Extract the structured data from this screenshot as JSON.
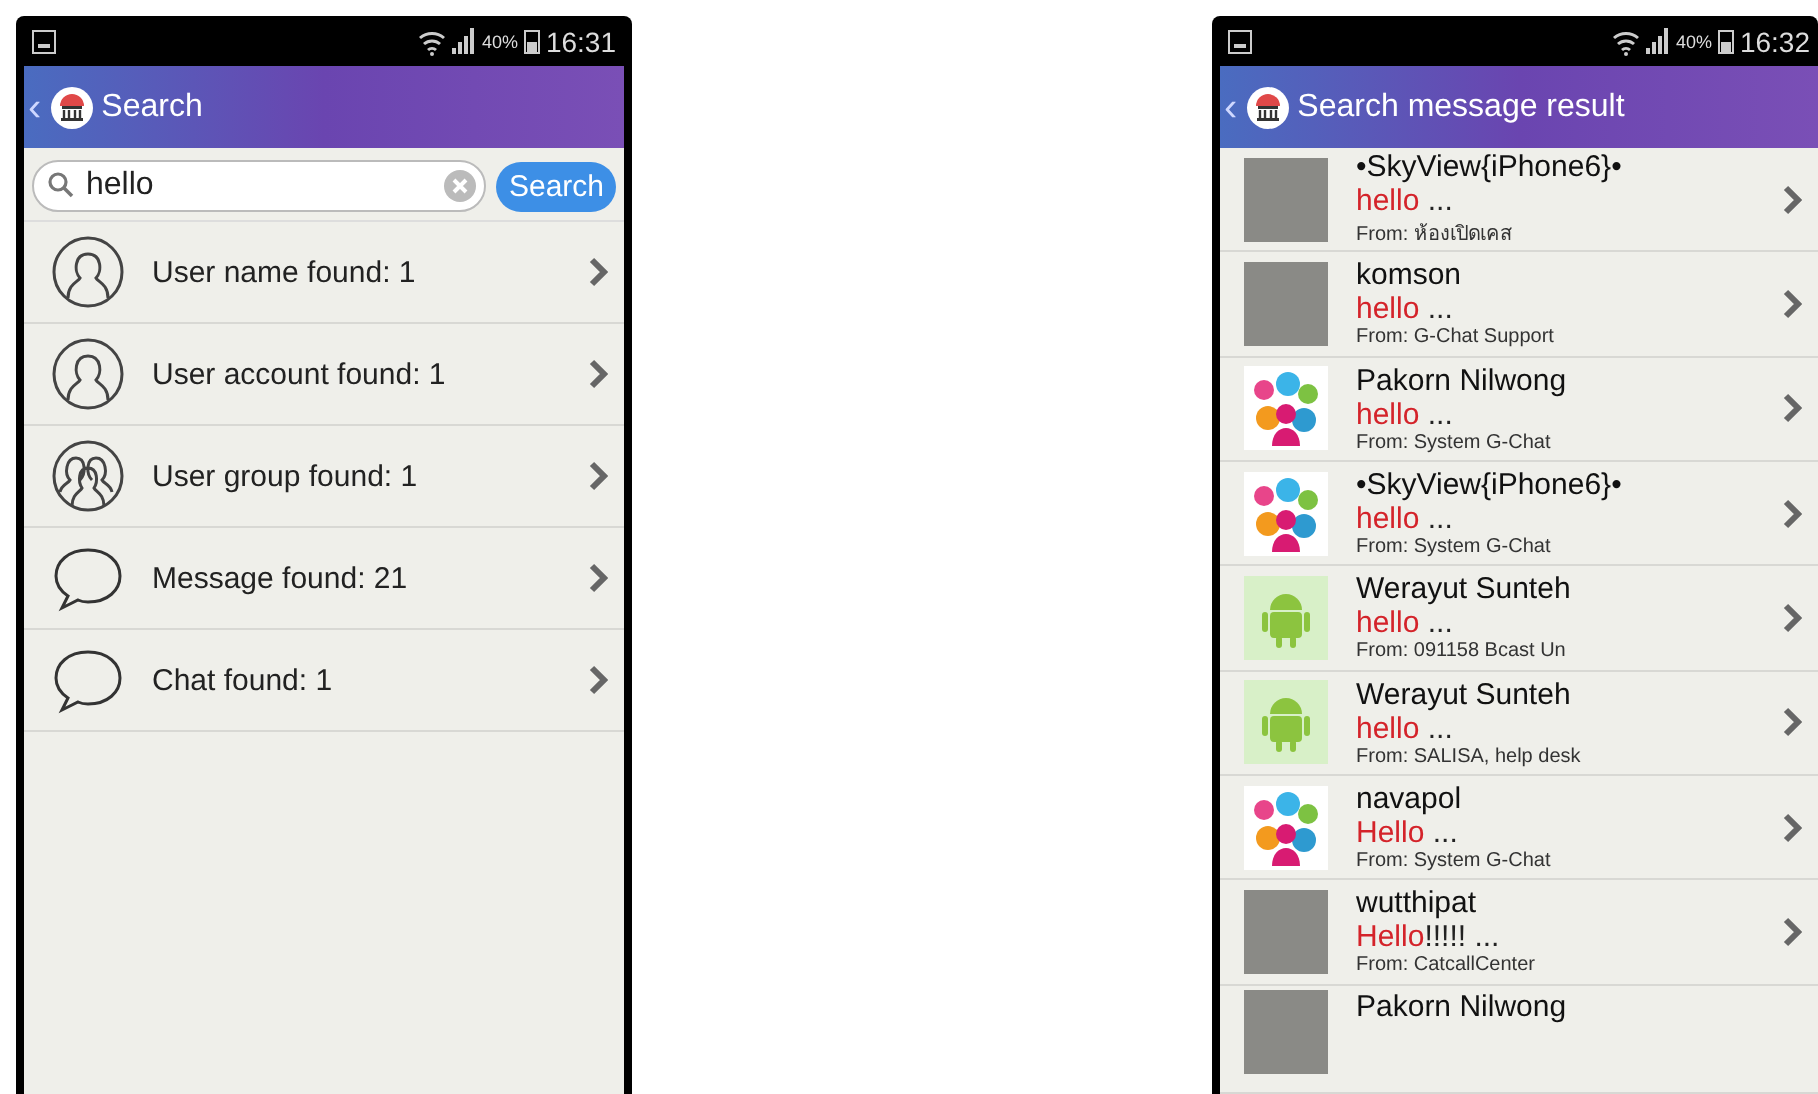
{
  "search_screen": {
    "status_bar": {
      "battery": "40%",
      "time": "16:31"
    },
    "app_bar": {
      "back": "‹",
      "title": "Search"
    },
    "search": {
      "value": "hello",
      "button": "Search"
    },
    "results": [
      {
        "kind": "user",
        "label": "User name found: 1"
      },
      {
        "kind": "user",
        "label": "User account found: 1"
      },
      {
        "kind": "group",
        "label": "User group found: 1"
      },
      {
        "kind": "message",
        "label": "Message found: 21"
      },
      {
        "kind": "message",
        "label": "Chat found: 1"
      }
    ]
  },
  "result_screen": {
    "status_bar": {
      "battery": "40%",
      "time": "16:32"
    },
    "app_bar": {
      "back": "‹",
      "title": "Search message result"
    },
    "messages": [
      {
        "kind": "photo",
        "name": "•SkyView{iPhone6}•",
        "match": "hello",
        "rest": " ...",
        "from": "From: ห้องเปิดเคส"
      },
      {
        "kind": "photo",
        "name": "komson",
        "match": "hello",
        "rest": " ...",
        "from": "From: G-Chat Support"
      },
      {
        "kind": "collage",
        "name": "Pakorn Nilwong",
        "match": "hello",
        "rest": " ...",
        "from": "From: System G-Chat"
      },
      {
        "kind": "collage",
        "name": "•SkyView{iPhone6}•",
        "match": "hello",
        "rest": " ...",
        "from": "From: System G-Chat"
      },
      {
        "kind": "android",
        "name": "Werayut Sunteh",
        "match": "hello",
        "rest": " ...",
        "from": "From: 091158 Bcast Un"
      },
      {
        "kind": "android",
        "name": "Werayut Sunteh",
        "match": "hello",
        "rest": " ...",
        "from": "From: SALISA, help desk"
      },
      {
        "kind": "collage",
        "name": "navapol",
        "match": "Hello",
        "rest": " ...",
        "from": "From: System G-Chat"
      },
      {
        "kind": "photo",
        "name": "wutthipat",
        "match": "Hello",
        "rest": "!!!!! ...",
        "from": "From: CatcallCenter"
      },
      {
        "kind": "photo",
        "name": "Pakorn Nilwong"
      }
    ]
  }
}
